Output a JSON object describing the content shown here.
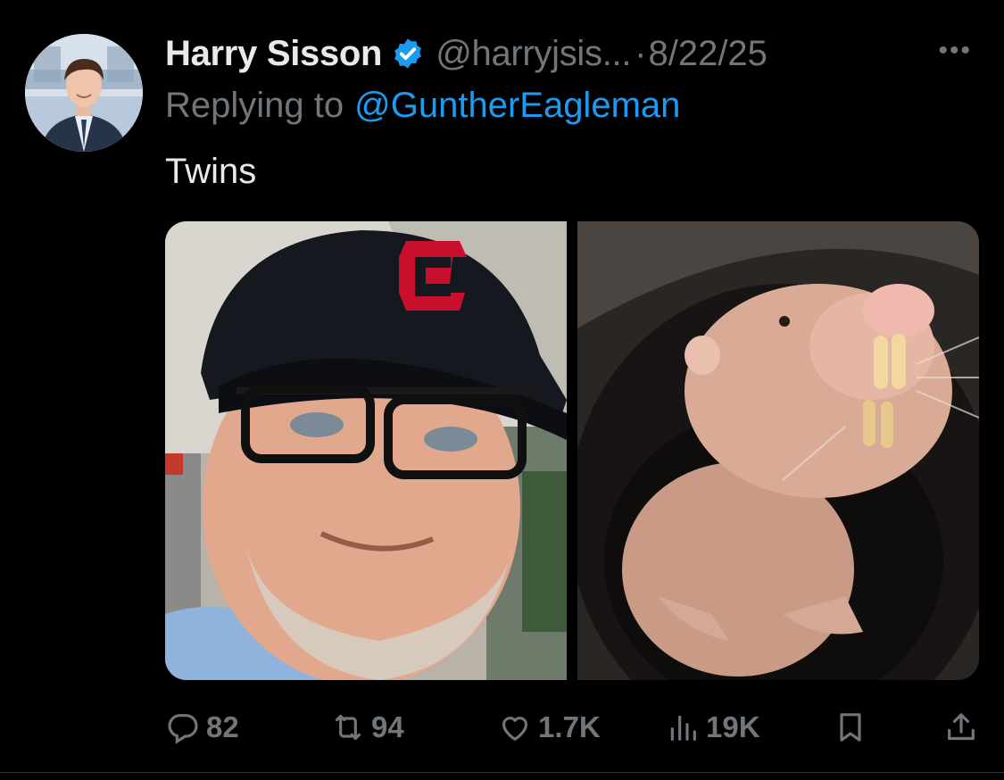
{
  "author": {
    "name": "Harry Sisson",
    "handle": "@harryjsis...",
    "separator": "·",
    "date": "8/22/25",
    "verified": true
  },
  "reply": {
    "prefix": "Replying to",
    "handle": "@GuntherEagleman"
  },
  "tweet": {
    "text": "Twins"
  },
  "media": [
    {
      "kind": "photo",
      "subject": "man in baseball cap and glasses selfie"
    },
    {
      "kind": "photo",
      "subject": "naked mole rat in tube"
    }
  ],
  "actions": {
    "replies": "82",
    "reposts": "94",
    "likes": "1.7K",
    "views": "19K"
  },
  "colors": {
    "background": "#000000",
    "text": "#e7e9ea",
    "muted": "#71767b",
    "accent": "#1d9bf0"
  },
  "icons": [
    "more-icon",
    "verified-icon",
    "reply-icon",
    "retweet-icon",
    "like-icon",
    "views-icon",
    "bookmark-icon",
    "share-icon"
  ]
}
